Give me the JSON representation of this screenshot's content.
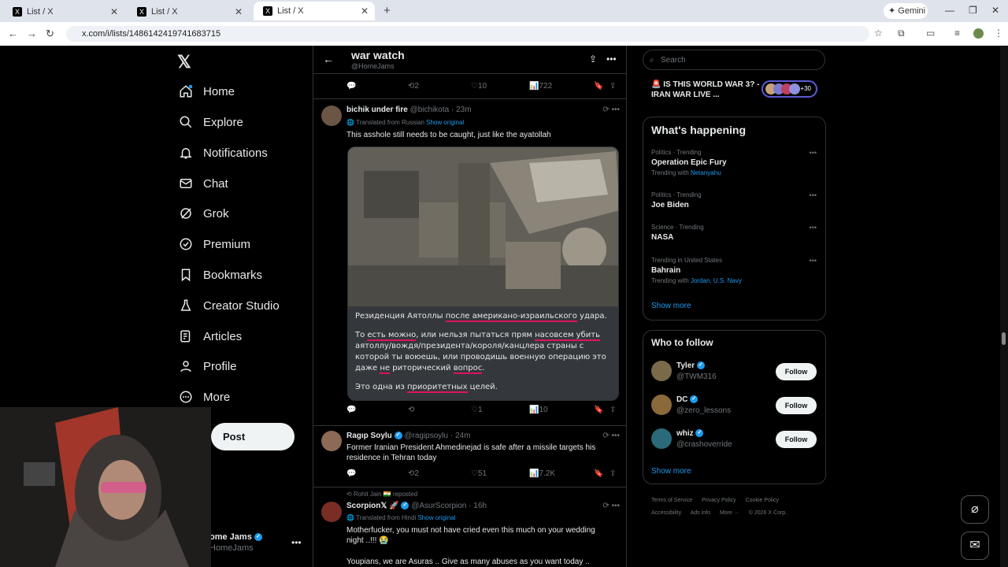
{
  "browser": {
    "tabs": [
      {
        "title": "List / X"
      },
      {
        "title": "List / X"
      },
      {
        "title": "List / X"
      }
    ],
    "gemini_label": "Gemini",
    "url": "x.com/i/lists/1486142419741683715"
  },
  "left_nav": {
    "items": [
      {
        "label": "Home",
        "icon": "home-icon"
      },
      {
        "label": "Explore",
        "icon": "search-icon"
      },
      {
        "label": "Notifications",
        "icon": "bell-icon"
      },
      {
        "label": "Chat",
        "icon": "mail-icon"
      },
      {
        "label": "Grok",
        "icon": "grok-icon"
      },
      {
        "label": "Premium",
        "icon": "premium-icon"
      },
      {
        "label": "Bookmarks",
        "icon": "bookmark-icon"
      },
      {
        "label": "Creator Studio",
        "icon": "flask-icon"
      },
      {
        "label": "Articles",
        "icon": "article-icon"
      },
      {
        "label": "Profile",
        "icon": "person-icon"
      },
      {
        "label": "More",
        "icon": "more-circle-icon"
      }
    ],
    "post_button": "Post",
    "account": {
      "name": "ome Jams",
      "handle": "HomeJams"
    }
  },
  "list_header": {
    "title": "war watch",
    "handle": "@HomeJams"
  },
  "top_actions": {
    "replies": "",
    "reposts": "2",
    "likes": "10",
    "views": "722"
  },
  "posts": [
    {
      "name": "bichik under fire",
      "handle": "@bichikota",
      "time": "23m",
      "translated": "Translated from Russian",
      "show_original": "Show original",
      "text": "This asshole still needs to be caught, just like the ayatollah",
      "caption": {
        "p1_a": "Резиденция Аятоллы ",
        "p1_u1": "после американо-израильского",
        "p1_b": " удара.",
        "p2_a": "То ",
        "p2_u1": "есть можно",
        "p2_b": ", или нельзя пытаться прям ",
        "p2_u2": "насовсем убить",
        "p2_c": " аятоллу/вождя/президента/короля/канцлера страны с которой ты воюешь, или проводишь военную операцию это даже ",
        "p2_u3": "не",
        "p2_d": " риторический ",
        "p2_u4": "вопрос",
        "p2_e": ".",
        "p3_a": "Это одна из ",
        "p3_u1": "приоритетных",
        "p3_b": " целей."
      },
      "actions": {
        "replies": "",
        "reposts": "",
        "likes": "1",
        "views": "10"
      }
    },
    {
      "name": "Ragıp Soylu",
      "handle": "@ragipsoylu",
      "time": "24m",
      "text": "Former Iranian President Ahmedinejad is safe after a missile targets his residence in Tehran today",
      "actions": {
        "replies": "",
        "reposts": "2",
        "likes": "51",
        "views": "7.2K"
      }
    },
    {
      "reposted_by": "Rohit Jain 🇮🇳 reposted",
      "name": "Scorpion𝕏 🚀",
      "handle": "@AsurScorpion",
      "time": "16h",
      "translated": "Translated from Hindi",
      "show_original": "Show original",
      "text1": "Motherfucker, you must not have cried even this much on your wedding night ..!!! 😭",
      "text2": "Youpians, we are Asuras .. Give as many abuses as you want today .."
    }
  ],
  "right": {
    "search_placeholder": "Search",
    "live": {
      "title": "IS THIS WORLD WAR 3? - IRAN WAR LIVE ...",
      "count": "+30"
    },
    "happening_title": "What's happening",
    "trends": [
      {
        "meta": "Politics · Trending",
        "name": "Operation Epic Fury",
        "with_label": "Trending with ",
        "with": "Netanyahu"
      },
      {
        "meta": "Politics · Trending",
        "name": "Joe Biden",
        "with_label": "",
        "with": ""
      },
      {
        "meta": "Science · Trending",
        "name": "NASA",
        "with_label": "",
        "with": ""
      },
      {
        "meta": "Trending in United States",
        "name": "Bahrain",
        "with_label": "Trending with ",
        "with": "Jordan, U.S. Navy"
      }
    ],
    "show_more": "Show more",
    "who_title": "Who to follow",
    "follows": [
      {
        "name": "Tyler",
        "handle": "@TWM316",
        "button": "Follow"
      },
      {
        "name": "DC",
        "handle": "@zero_lessons",
        "button": "Follow"
      },
      {
        "name": "whiz",
        "handle": "@crashoverride",
        "button": "Follow"
      }
    ],
    "footer": [
      "Terms of Service",
      "Privacy Policy",
      "Cookie Policy",
      "Accessibility",
      "Ads info",
      "More ···",
      "© 2026 X Corp."
    ]
  },
  "colors": {
    "accent": "#1d9bf0",
    "background": "#000000",
    "border": "#2f3336",
    "underline": "#e0125f"
  }
}
